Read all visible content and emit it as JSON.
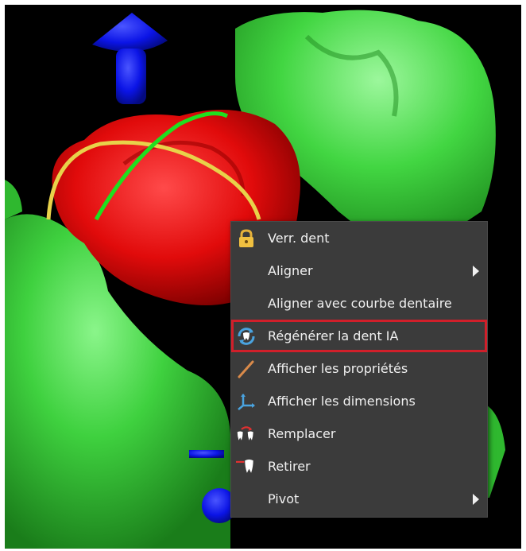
{
  "context_menu": {
    "items": [
      {
        "label": "Verr. dent",
        "icon": "lock-icon",
        "submenu": false
      },
      {
        "label": "Aligner",
        "icon": "",
        "submenu": true
      },
      {
        "label": "Aligner avec courbe dentaire",
        "icon": "",
        "submenu": false
      },
      {
        "label": "Régénérer la dent IA",
        "icon": "ai-regenerate-tooth-icon",
        "submenu": false,
        "highlighted": true
      },
      {
        "label": "Afficher les propriétés",
        "icon": "pencil-icon",
        "submenu": false
      },
      {
        "label": "Afficher les dimensions",
        "icon": "axes-icon",
        "submenu": false
      },
      {
        "label": "Remplacer",
        "icon": "replace-tooth-icon",
        "submenu": false
      },
      {
        "label": "Retirer",
        "icon": "remove-tooth-icon",
        "submenu": false
      },
      {
        "label": "Pivot",
        "icon": "",
        "submenu": true
      }
    ],
    "highlight_color": "#d11f2a"
  },
  "scene": {
    "background": "#000000",
    "gum_color": "#3fd13f",
    "tooth_color": "#e10b0b",
    "gizmo_colors": [
      "#0b14e6",
      "#1fe01f",
      "#e8d24a"
    ]
  }
}
